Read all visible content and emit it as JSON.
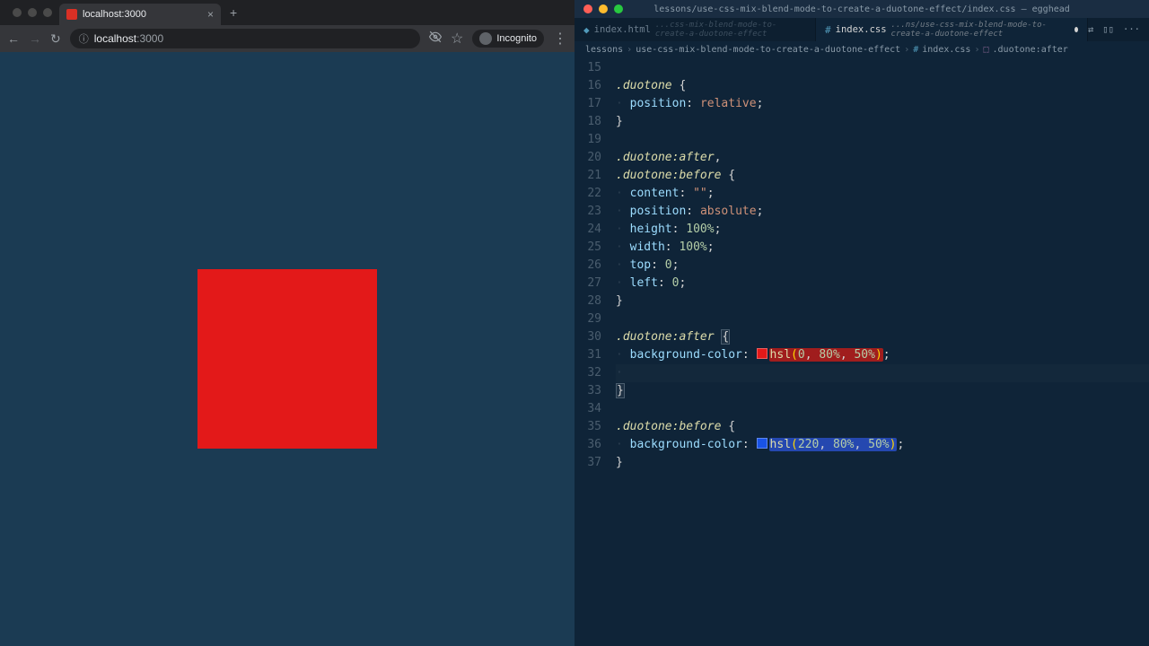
{
  "browser": {
    "tab_title": "localhost:3000",
    "new_tab": "+",
    "tab_close": "×",
    "nav": {
      "back": "←",
      "fwd": "→",
      "reload": "↻"
    },
    "address_icon": "ⓘ",
    "address_host": "localhost",
    "address_path": ":3000",
    "eye_icon": "👁",
    "star_icon": "☆",
    "incognito_label": "Incognito",
    "menu_icon": "⋮",
    "square_color": "#e31919"
  },
  "editor": {
    "title": "lessons/use-css-mix-blend-mode-to-create-a-duotone-effect/index.css — egghead",
    "tabs": [
      {
        "name": "index.html",
        "path": "...css-mix-blend-mode-to-create-a-duotone-effect",
        "active": false,
        "dirty": false
      },
      {
        "name": "index.css",
        "path": "...ns/use-css-mix-blend-mode-to-create-a-duotone-effect",
        "active": true,
        "dirty": true
      }
    ],
    "tabs_right": {
      "diff": "⇄",
      "split": "▯▯",
      "more": "···"
    },
    "breadcrumbs": [
      "lessons",
      "use-css-mix-blend-mode-to-create-a-duotone-effect",
      "index.css",
      ".duotone:after"
    ],
    "bc_sep": "›",
    "lines_start": 15,
    "code": [
      {
        "n": 15,
        "html": ""
      },
      {
        "n": 16,
        "html": "<span class='tok-sel'>.duotone</span> <span class='tok-punc'>{</span>"
      },
      {
        "n": 17,
        "html": "<span class='indent-guide'>·</span> <span class='tok-prop'>position</span><span class='tok-punc'>:</span> <span class='tok-val'>relative</span><span class='tok-punc'>;</span>"
      },
      {
        "n": 18,
        "html": "<span class='tok-punc'>}</span>"
      },
      {
        "n": 19,
        "html": ""
      },
      {
        "n": 20,
        "html": "<span class='tok-sel'>.duotone:after</span><span class='tok-punc'>,</span>"
      },
      {
        "n": 21,
        "html": "<span class='tok-sel'>.duotone:before</span> <span class='tok-punc'>{</span>"
      },
      {
        "n": 22,
        "html": "<span class='indent-guide'>·</span> <span class='tok-prop'>content</span><span class='tok-punc'>:</span> <span class='tok-val'>\"\"</span><span class='tok-punc'>;</span>"
      },
      {
        "n": 23,
        "html": "<span class='indent-guide'>·</span> <span class='tok-prop'>position</span><span class='tok-punc'>:</span> <span class='tok-val'>absolute</span><span class='tok-punc'>;</span>"
      },
      {
        "n": 24,
        "html": "<span class='indent-guide'>·</span> <span class='tok-prop'>height</span><span class='tok-punc'>:</span> <span class='tok-num'>100%</span><span class='tok-punc'>;</span>"
      },
      {
        "n": 25,
        "html": "<span class='indent-guide'>·</span> <span class='tok-prop'>width</span><span class='tok-punc'>:</span> <span class='tok-num'>100%</span><span class='tok-punc'>;</span>"
      },
      {
        "n": 26,
        "html": "<span class='indent-guide'>·</span> <span class='tok-prop'>top</span><span class='tok-punc'>:</span> <span class='tok-num'>0</span><span class='tok-punc'>;</span>"
      },
      {
        "n": 27,
        "html": "<span class='indent-guide'>·</span> <span class='tok-prop'>left</span><span class='tok-punc'>:</span> <span class='tok-num'>0</span><span class='tok-punc'>;</span>"
      },
      {
        "n": 28,
        "html": "<span class='tok-punc'>}</span>"
      },
      {
        "n": 29,
        "html": ""
      },
      {
        "n": 30,
        "html": "<span class='tok-sel'>.duotone:after</span> <span class='tok-brace-hl'>{</span>"
      },
      {
        "n": 31,
        "html": "<span class='indent-guide'>·</span> <span class='tok-prop'>background-color</span><span class='tok-punc'>:</span> <span class='swatch swatch-red'></span><span class='hl-red'><span class='tok-func'>hsl</span><span class='tok-paren'>(</span><span class='tok-num'>0</span><span class='tok-punc'>,</span> <span class='tok-num'>80%</span><span class='tok-punc'>,</span> <span class='tok-num'>50%</span><span class='tok-paren'>)</span></span><span class='tok-punc'>;</span>"
      },
      {
        "n": 32,
        "html": "<span class='indent-guide'>·</span> <span class='tok-punc'></span>",
        "cursor": true
      },
      {
        "n": 33,
        "html": "<span class='tok-brace-hl'>}</span>"
      },
      {
        "n": 34,
        "html": ""
      },
      {
        "n": 35,
        "html": "<span class='tok-sel'>.duotone:before</span> <span class='tok-punc'>{</span>"
      },
      {
        "n": 36,
        "html": "<span class='indent-guide'>·</span> <span class='tok-prop'>background-color</span><span class='tok-punc'>:</span> <span class='swatch swatch-blue'></span><span class='hl-blue'><span class='tok-func'>hsl</span><span class='tok-paren'>(</span><span class='tok-num'>220</span><span class='tok-punc'>,</span> <span class='tok-num'>80%</span><span class='tok-punc'>,</span> <span class='tok-num'>50%</span><span class='tok-paren'>)</span></span><span class='tok-punc'>;</span>"
      },
      {
        "n": 37,
        "html": "<span class='tok-punc'>}</span>"
      }
    ]
  }
}
